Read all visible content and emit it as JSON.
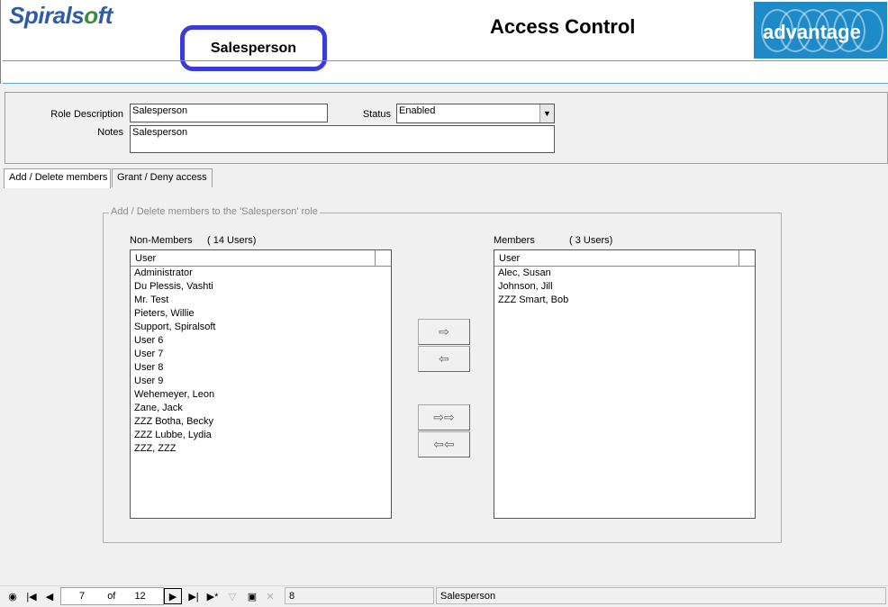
{
  "header": {
    "brand_part1": "Spiral",
    "brand_part2": "s",
    "brand_o": "o",
    "brand_part3": "ft",
    "role_name": "Salesperson",
    "page_title": "Access Control",
    "product_logo": "advantage"
  },
  "form": {
    "role_description_label": "Role Description",
    "role_description_value": "Salesperson",
    "status_label": "Status",
    "status_value": "Enabled",
    "notes_label": "Notes",
    "notes_value": "Salesperson"
  },
  "tabs": [
    {
      "label": "Add / Delete members",
      "active": true
    },
    {
      "label": "Grant / Deny access",
      "active": false
    }
  ],
  "group": {
    "legend": "Add / Delete members to the 'Salesperson' role",
    "non_members": {
      "caption": "Non-Members",
      "count": "( 14 Users)",
      "column": "User",
      "items": [
        "Administrator",
        "Du Plessis, Vashti",
        "Mr. Test",
        "Pieters, Willie",
        "Support, Spiralsoft",
        "User 6",
        "User 7",
        "User 8",
        "User 9",
        "Wehemeyer, Leon",
        "Zane, Jack",
        "ZZZ Botha, Becky",
        "ZZZ Lubbe, Lydia",
        "ZZZ, ZZZ"
      ]
    },
    "members": {
      "caption": "Members",
      "count": "( 3 Users)",
      "column": "User",
      "items": [
        "Alec, Susan",
        "Johnson, Jill",
        "ZZZ Smart, Bob"
      ]
    },
    "buttons": {
      "add_one": "⇨",
      "remove_one": "⇦",
      "add_all": "⇨⇨",
      "remove_all": "⇦⇦"
    }
  },
  "statusbar": {
    "record_current": "7",
    "record_of": "of",
    "record_total": "12",
    "field_value": "8",
    "status_text": "Salesperson",
    "icons": [
      "binoculars-icon",
      "first-record-icon",
      "prev-record-icon",
      "next-record-icon",
      "last-record-icon",
      "new-record-icon",
      "filter-icon",
      "save-icon",
      "delete-icon"
    ]
  }
}
